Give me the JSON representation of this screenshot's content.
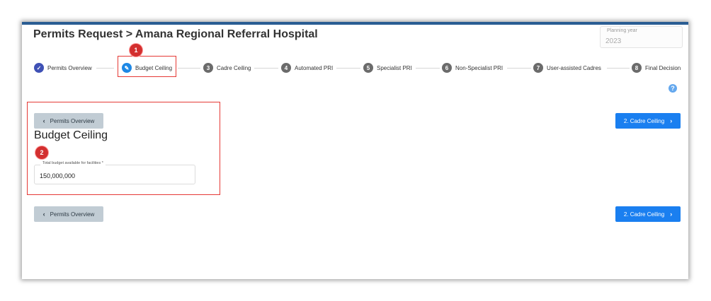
{
  "header": {
    "title": "Permits Request > Amana Regional Referral Hospital",
    "planning_year_label": "Planning year",
    "planning_year_value": "2023"
  },
  "steps": [
    {
      "number": "✓",
      "label": "Permits Overview",
      "status": "completed",
      "icon": "check-icon"
    },
    {
      "number": "✎",
      "label": "Budget Ceiling",
      "status": "active",
      "icon": "pencil-icon"
    },
    {
      "number": "3",
      "label": "Cadre Ceiling",
      "status": "pending"
    },
    {
      "number": "4",
      "label": "Automated PRI",
      "status": "pending"
    },
    {
      "number": "5",
      "label": "Specialist PRI",
      "status": "pending"
    },
    {
      "number": "6",
      "label": "Non-Specialist PRI",
      "status": "pending"
    },
    {
      "number": "7",
      "label": "User-assisted Cadres",
      "status": "pending"
    },
    {
      "number": "8",
      "label": "Final Decision",
      "status": "pending"
    }
  ],
  "annotations": {
    "badge1": "1",
    "badge2": "2"
  },
  "help_icon": "?",
  "nav": {
    "back_label": "Permits Overview",
    "next_label": "2. Cadre Ceiling",
    "back_icon": "chevron-left-icon",
    "next_icon": "chevron-right-icon"
  },
  "section": {
    "title": "Budget Ceiling",
    "field_label": "Total budget available for facilities *",
    "field_value": "150,000,000"
  },
  "colors": {
    "header_bar": "#2a5d93",
    "step_completed": "#3f51b5",
    "step_active": "#1e88e5",
    "step_pending": "#6b6b6b",
    "primary_button": "#1a7ff0",
    "secondary_button": "#c1ccd4",
    "annotation_red": "#d32f2f"
  }
}
